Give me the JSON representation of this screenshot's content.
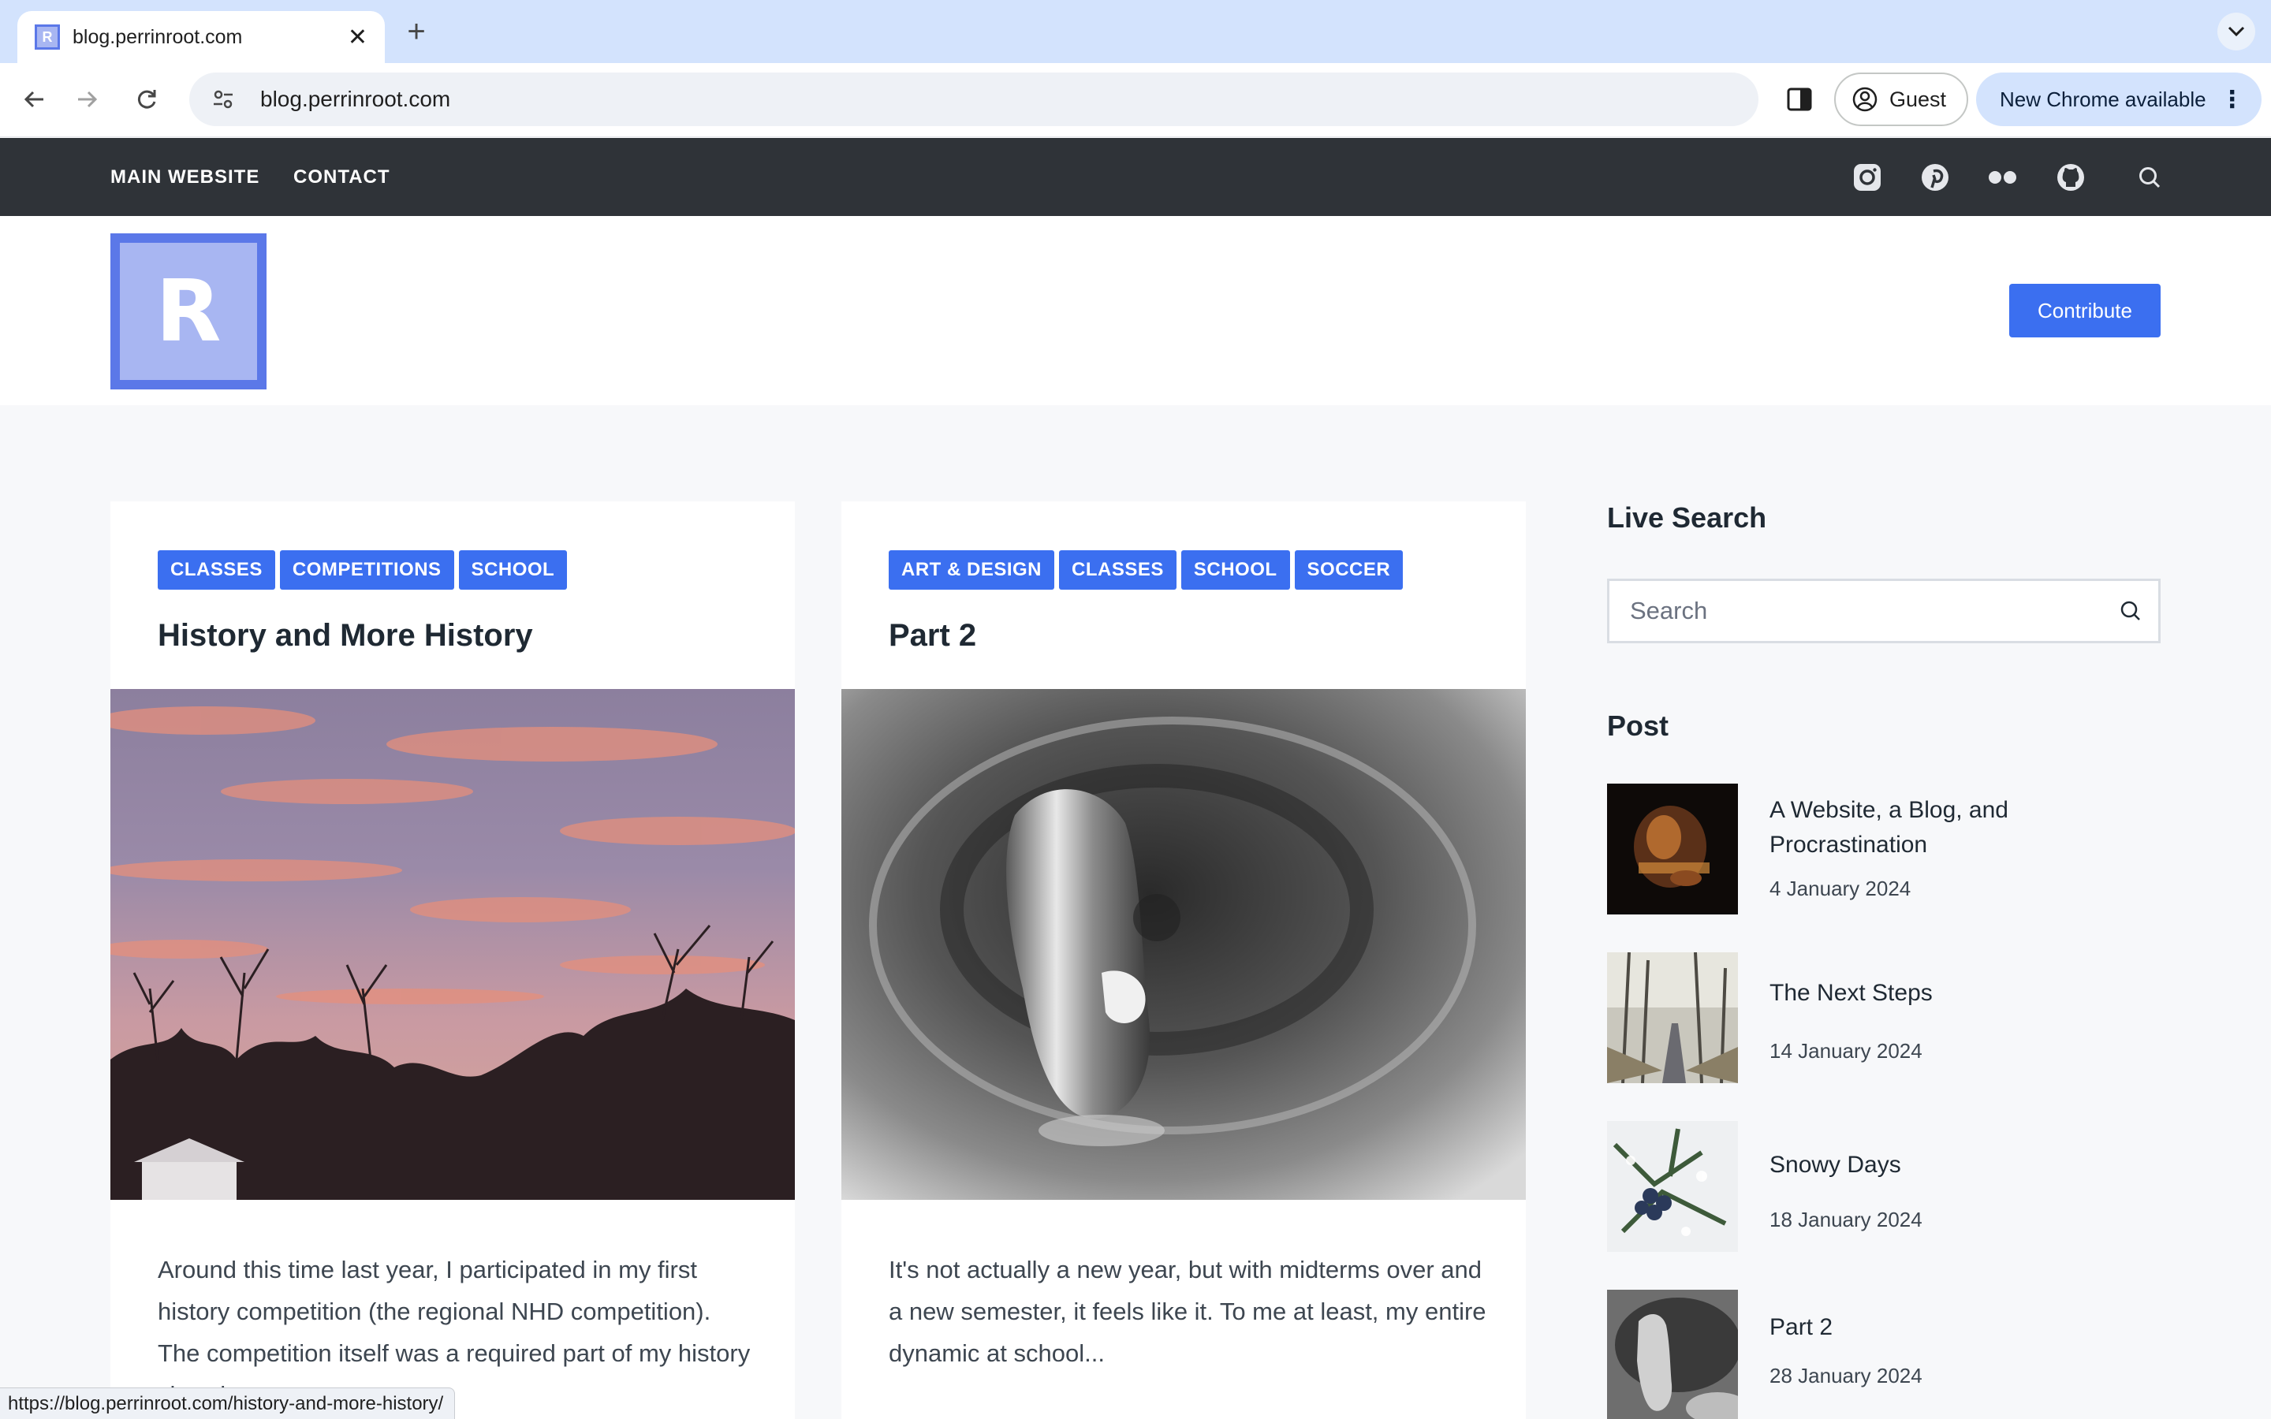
{
  "browser": {
    "tab_title": "blog.perrinroot.com",
    "url": "blog.perrinroot.com",
    "profile_label": "Guest",
    "update_label": "New Chrome available",
    "status_url": "https://blog.perrinroot.com/history-and-more-history/"
  },
  "topnav": {
    "items": [
      "MAIN WEBSITE",
      "CONTACT"
    ],
    "social_icons": [
      "instagram-icon",
      "pinterest-icon",
      "flickr-icon",
      "github-icon",
      "search-icon"
    ]
  },
  "header": {
    "logo_letter": "R",
    "contribute_label": "Contribute"
  },
  "posts": [
    {
      "tags": [
        "CLASSES",
        "COMPETITIONS",
        "SCHOOL"
      ],
      "title": "History and More History",
      "excerpt": "Around this time last year, I participated in my first history competition (the regional NHD competition). The competition itself was a required part of my history class last year."
    },
    {
      "tags": [
        "ART & DESIGN",
        "CLASSES",
        "SCHOOL",
        "SOCCER"
      ],
      "title": "Part 2",
      "excerpt": "It's not actually a new year, but with midterms over and a new semester, it feels like it. To me at least, my entire dynamic at school..."
    }
  ],
  "sidebar": {
    "live_search_title": "Live Search",
    "search_placeholder": "Search",
    "post_title": "Post",
    "recent": [
      {
        "title": "A Website, a Blog, and Procrastination",
        "date": "4 January 2024"
      },
      {
        "title": "The Next Steps",
        "date": "14 January 2024"
      },
      {
        "title": "Snowy Days",
        "date": "18 January 2024"
      },
      {
        "title": "Part 2",
        "date": "28 January 2024"
      }
    ]
  },
  "colors": {
    "accent": "#3b6ff0",
    "topbar": "#2f3338",
    "logo_fill": "#a8b6f2",
    "logo_border": "#5b78e8"
  }
}
